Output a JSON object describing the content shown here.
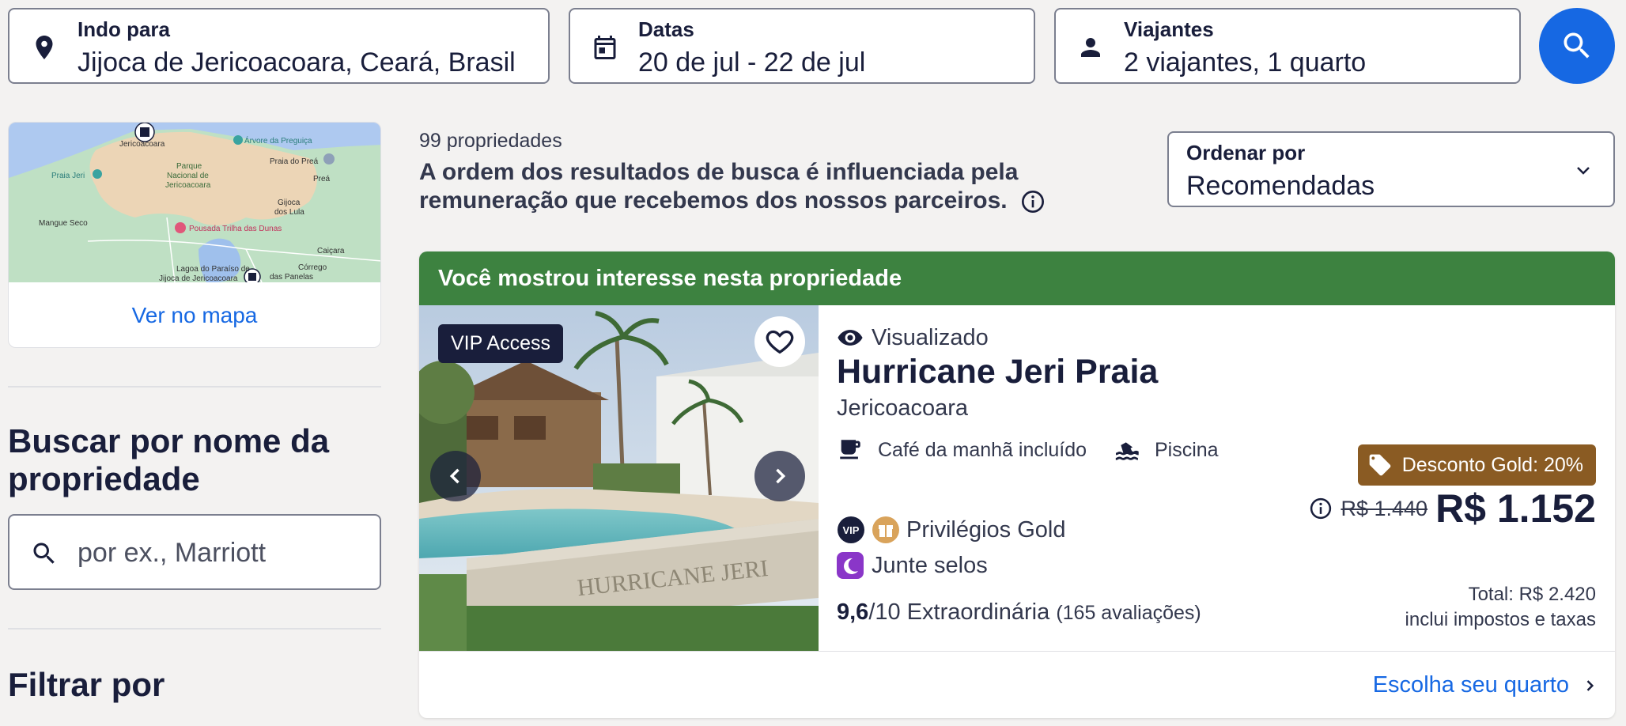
{
  "search": {
    "destination": {
      "label": "Indo para",
      "value": "Jijoca de Jericoacoara, Ceará, Brasil",
      "icon": "location-pin-icon"
    },
    "dates": {
      "label": "Datas",
      "value": "20 de jul - 22 de jul",
      "icon": "calendar-icon"
    },
    "travelers": {
      "label": "Viajantes",
      "value": "2 viajantes, 1 quarto",
      "icon": "person-icon"
    },
    "button_icon": "search-icon"
  },
  "map": {
    "link_label": "Ver no mapa",
    "labels": {
      "jericoacoara": "Jericoacoara",
      "arvore": "Árvore da Preguiça",
      "parque_1": "Parque",
      "parque_2": "Nacional de",
      "parque_3": "Jericoacoara",
      "praia_do_preá": "Praia do Preá",
      "prea": "Preá",
      "praia_jeri": "Praia Jeri",
      "gijoca_1": "Gijoca",
      "gijoca_2": "dos Lula",
      "mangue": "Mangue Seco",
      "pousada": "Pousada Trilha das Dunas",
      "caicara": "Caiçara",
      "corrego_1": "Córrego",
      "corrego_2": "das Panelas",
      "lagoa_1": "Lagoa do Paraíso de",
      "lagoa_2": "Jijoca de Jericoacoara"
    }
  },
  "sidebar": {
    "name_search_heading": "Buscar por nome da propriedade",
    "name_search_placeholder": "por ex., Marriott",
    "filter_heading": "Filtrar por"
  },
  "results": {
    "count": "99 propriedades",
    "notice": "A ordem dos resultados de busca é influenciada pela remuneração que recebemos dos nossos parceiros.",
    "sort": {
      "label": "Ordenar por",
      "value": "Recomendadas"
    }
  },
  "property": {
    "banner": "Você mostrou interesse nesta propriedade",
    "vip_badge": "VIP Access",
    "viewed": "Visualizado",
    "name": "Hurricane Jeri Praia",
    "location": "Jericoacoara",
    "amenities": [
      {
        "label": "Café da manhã incluído",
        "icon": "coffee-cup-icon"
      },
      {
        "label": "Piscina",
        "icon": "pool-icon"
      }
    ],
    "vip_icon_text": "VIP",
    "privileges": "Privilégios Gold",
    "stamps": "Junte selos",
    "rating": {
      "score": "9,6",
      "scale": "/10",
      "word": "Extraordinária",
      "reviews": "(165 avaliações)"
    },
    "discount": "Desconto Gold: 20%",
    "old_price": "R$ 1.440",
    "price": "R$ 1.152",
    "total": "Total: R$ 2.420",
    "taxes": "inclui impostos e taxas",
    "choose_room": "Escolha seu quarto",
    "photo_sign": "HURRICANE JERI"
  },
  "colors": {
    "accent": "#1668e3",
    "banner_green": "#3d8240",
    "discount_brown": "#8a5b23",
    "text_dark": "#191e3b"
  }
}
